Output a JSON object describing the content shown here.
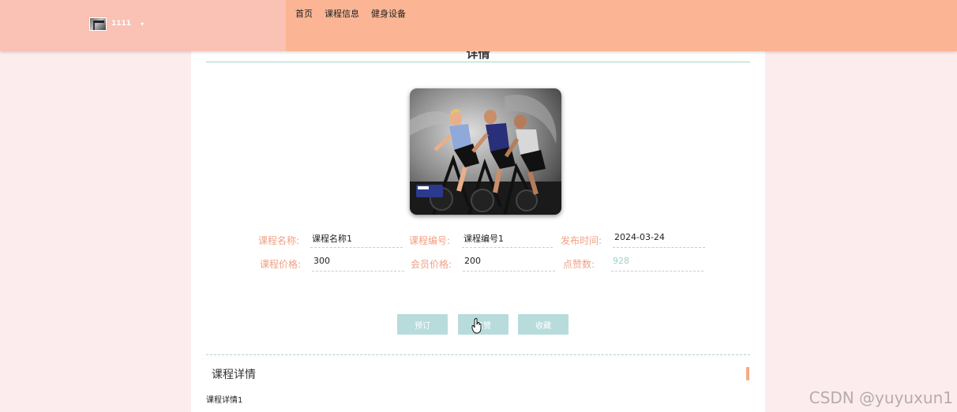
{
  "header": {
    "username": "1111",
    "caret": "▾",
    "nav": [
      "首页",
      "课程信息",
      "健身设备"
    ]
  },
  "page": {
    "title": "详情"
  },
  "fields": {
    "course_name": {
      "label": "课程名称:",
      "value": "课程名称1"
    },
    "course_code": {
      "label": "课程编号:",
      "value": "课程编号1"
    },
    "publish_time": {
      "label": "发布时间:",
      "value": "2024-03-24"
    },
    "price": {
      "label": "课程价格:",
      "value": "300"
    },
    "member_price": {
      "label": "会员价格:",
      "value": "200"
    },
    "likes": {
      "label": "点赞数:",
      "value": "928"
    }
  },
  "buttons": {
    "book": "预订",
    "like": "点赞",
    "favorite": "收藏"
  },
  "details": {
    "title": "课程详情",
    "body": "课程详情1"
  },
  "watermark": "CSDN @yuyuxun1",
  "colors": {
    "header": "#fbb594",
    "header_left": "#fac1b5",
    "background": "#fdeced",
    "label": "#f0a085",
    "button": "#b8dcdc",
    "accent_rule": "#a8d4cf"
  }
}
